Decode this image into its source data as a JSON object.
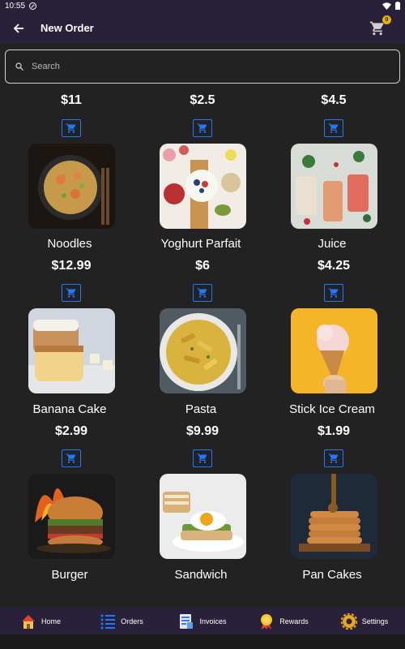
{
  "status": {
    "time": "10:55"
  },
  "header": {
    "title": "New Order",
    "cart_count": "0"
  },
  "search": {
    "placeholder": "Search"
  },
  "top_prices": [
    "$11",
    "$2.5",
    "$4.5"
  ],
  "products": [
    {
      "name": "Noodles",
      "price": "$12.99"
    },
    {
      "name": "Yoghurt Parfait",
      "price": "$6"
    },
    {
      "name": "Juice",
      "price": "$4.25"
    },
    {
      "name": "Banana Cake",
      "price": "$2.99"
    },
    {
      "name": "Pasta",
      "price": "$9.99"
    },
    {
      "name": "Stick Ice Cream",
      "price": "$1.99"
    },
    {
      "name": "Burger",
      "price": ""
    },
    {
      "name": "Sandwich",
      "price": ""
    },
    {
      "name": "Pan Cakes",
      "price": ""
    }
  ],
  "nav": [
    "Home",
    "Orders",
    "Invoices",
    "Rewards",
    "Settings"
  ],
  "colors": {
    "accent": "#2277ff",
    "bar": "#29213a",
    "background": "#222222",
    "badge": "#e6b400"
  }
}
